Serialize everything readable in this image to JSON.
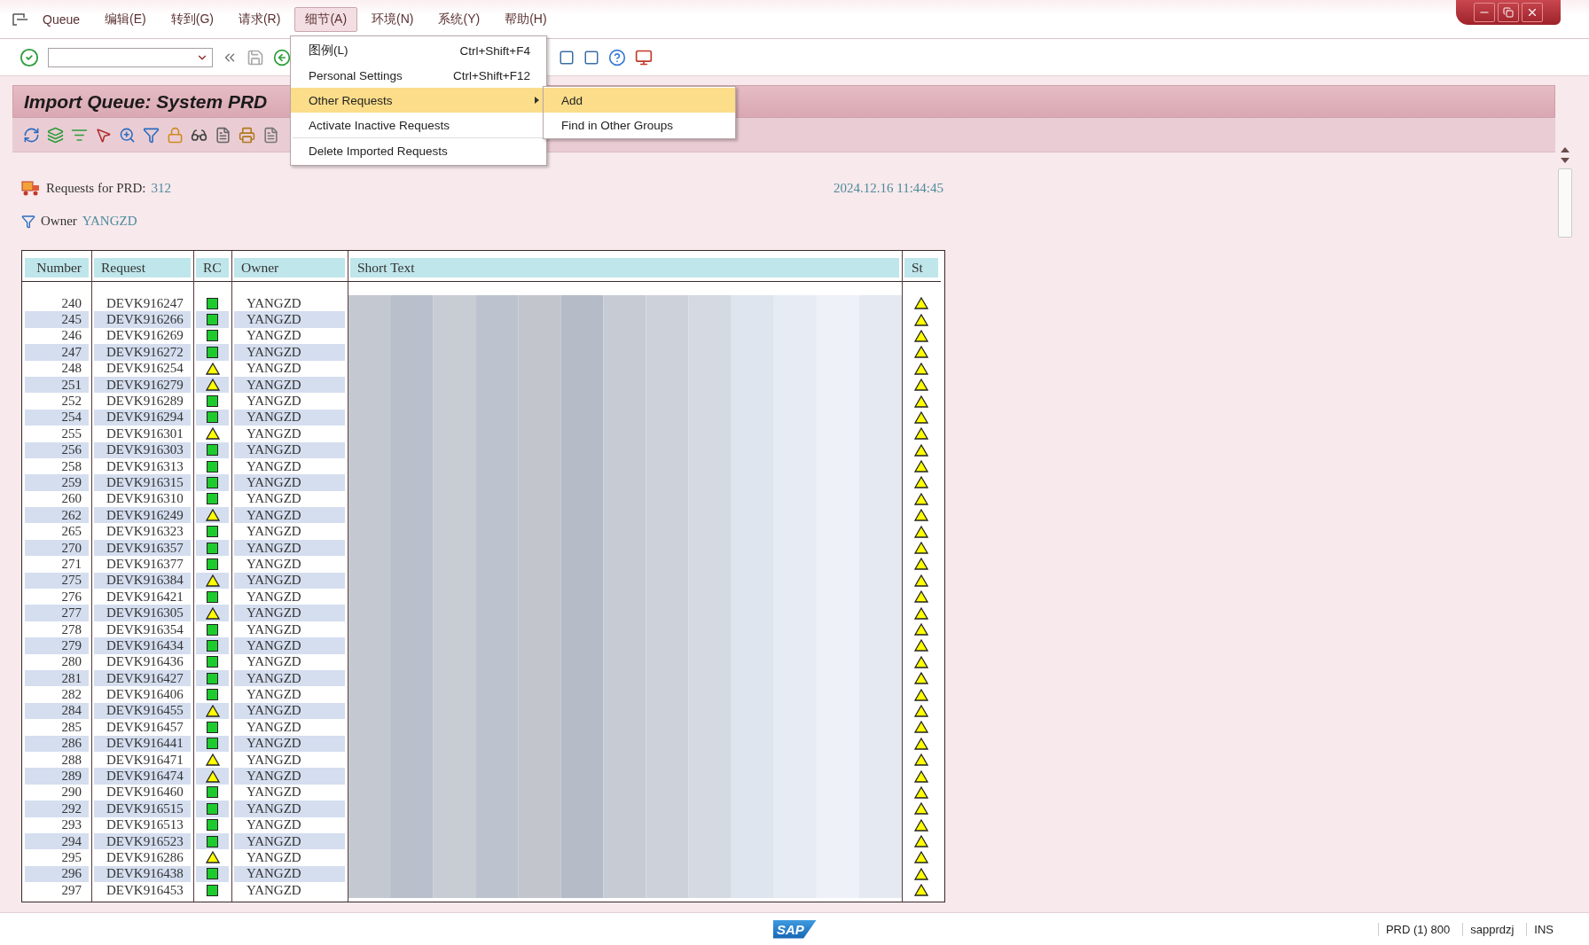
{
  "menu_bar": {
    "items": [
      {
        "label": "Queue",
        "selected": false
      },
      {
        "label": "编辑(E)",
        "selected": false
      },
      {
        "label": "转到(G)",
        "selected": false
      },
      {
        "label": "请求(R)",
        "selected": false
      },
      {
        "label": "细节(A)",
        "selected": true
      },
      {
        "label": "环境(N)",
        "selected": false
      },
      {
        "label": "系统(Y)",
        "selected": false
      },
      {
        "label": "帮助(H)",
        "selected": false
      }
    ]
  },
  "title": "Import Queue: System PRD",
  "info": {
    "requests_label": "Requests for PRD:",
    "requests_count": "312",
    "timestamp": "2024.12.16 11:44:45",
    "owner_label": "Owner",
    "owner_value": "YANGZD"
  },
  "table": {
    "columns": [
      "Number",
      "Request",
      "RC",
      "Owner",
      "Short Text",
      "St"
    ],
    "rows": [
      {
        "number": "240",
        "request": "DEVK916247",
        "rc_warning": false,
        "owner": "YANGZD",
        "st_warning": true
      },
      {
        "number": "245",
        "request": "DEVK916266",
        "rc_warning": false,
        "owner": "YANGZD",
        "st_warning": true
      },
      {
        "number": "246",
        "request": "DEVK916269",
        "rc_warning": false,
        "owner": "YANGZD",
        "st_warning": true
      },
      {
        "number": "247",
        "request": "DEVK916272",
        "rc_warning": false,
        "owner": "YANGZD",
        "st_warning": true
      },
      {
        "number": "248",
        "request": "DEVK916254",
        "rc_warning": true,
        "owner": "YANGZD",
        "st_warning": true
      },
      {
        "number": "251",
        "request": "DEVK916279",
        "rc_warning": true,
        "owner": "YANGZD",
        "st_warning": true
      },
      {
        "number": "252",
        "request": "DEVK916289",
        "rc_warning": false,
        "owner": "YANGZD",
        "st_warning": true
      },
      {
        "number": "254",
        "request": "DEVK916294",
        "rc_warning": false,
        "owner": "YANGZD",
        "st_warning": true
      },
      {
        "number": "255",
        "request": "DEVK916301",
        "rc_warning": true,
        "owner": "YANGZD",
        "st_warning": true
      },
      {
        "number": "256",
        "request": "DEVK916303",
        "rc_warning": false,
        "owner": "YANGZD",
        "st_warning": true
      },
      {
        "number": "258",
        "request": "DEVK916313",
        "rc_warning": false,
        "owner": "YANGZD",
        "st_warning": true
      },
      {
        "number": "259",
        "request": "DEVK916315",
        "rc_warning": false,
        "owner": "YANGZD",
        "st_warning": true
      },
      {
        "number": "260",
        "request": "DEVK916310",
        "rc_warning": false,
        "owner": "YANGZD",
        "st_warning": true
      },
      {
        "number": "262",
        "request": "DEVK916249",
        "rc_warning": true,
        "owner": "YANGZD",
        "st_warning": true
      },
      {
        "number": "265",
        "request": "DEVK916323",
        "rc_warning": false,
        "owner": "YANGZD",
        "st_warning": true
      },
      {
        "number": "270",
        "request": "DEVK916357",
        "rc_warning": false,
        "owner": "YANGZD",
        "st_warning": true
      },
      {
        "number": "271",
        "request": "DEVK916377",
        "rc_warning": false,
        "owner": "YANGZD",
        "st_warning": true
      },
      {
        "number": "275",
        "request": "DEVK916384",
        "rc_warning": true,
        "owner": "YANGZD",
        "st_warning": true
      },
      {
        "number": "276",
        "request": "DEVK916421",
        "rc_warning": false,
        "owner": "YANGZD",
        "st_warning": true
      },
      {
        "number": "277",
        "request": "DEVK916305",
        "rc_warning": true,
        "owner": "YANGZD",
        "st_warning": true
      },
      {
        "number": "278",
        "request": "DEVK916354",
        "rc_warning": false,
        "owner": "YANGZD",
        "st_warning": true
      },
      {
        "number": "279",
        "request": "DEVK916434",
        "rc_warning": false,
        "owner": "YANGZD",
        "st_warning": true
      },
      {
        "number": "280",
        "request": "DEVK916436",
        "rc_warning": false,
        "owner": "YANGZD",
        "st_warning": true
      },
      {
        "number": "281",
        "request": "DEVK916427",
        "rc_warning": false,
        "owner": "YANGZD",
        "st_warning": true
      },
      {
        "number": "282",
        "request": "DEVK916406",
        "rc_warning": false,
        "owner": "YANGZD",
        "st_warning": true
      },
      {
        "number": "284",
        "request": "DEVK916455",
        "rc_warning": true,
        "owner": "YANGZD",
        "st_warning": true
      },
      {
        "number": "285",
        "request": "DEVK916457",
        "rc_warning": false,
        "owner": "YANGZD",
        "st_warning": true
      },
      {
        "number": "286",
        "request": "DEVK916441",
        "rc_warning": false,
        "owner": "YANGZD",
        "st_warning": true
      },
      {
        "number": "288",
        "request": "DEVK916471",
        "rc_warning": true,
        "owner": "YANGZD",
        "st_warning": true
      },
      {
        "number": "289",
        "request": "DEVK916474",
        "rc_warning": true,
        "owner": "YANGZD",
        "st_warning": true
      },
      {
        "number": "290",
        "request": "DEVK916460",
        "rc_warning": false,
        "owner": "YANGZD",
        "st_warning": true
      },
      {
        "number": "292",
        "request": "DEVK916515",
        "rc_warning": false,
        "owner": "YANGZD",
        "st_warning": true
      },
      {
        "number": "293",
        "request": "DEVK916513",
        "rc_warning": false,
        "owner": "YANGZD",
        "st_warning": true
      },
      {
        "number": "294",
        "request": "DEVK916523",
        "rc_warning": false,
        "owner": "YANGZD",
        "st_warning": true
      },
      {
        "number": "295",
        "request": "DEVK916286",
        "rc_warning": true,
        "owner": "YANGZD",
        "st_warning": true
      },
      {
        "number": "296",
        "request": "DEVK916438",
        "rc_warning": false,
        "owner": "YANGZD",
        "st_warning": true
      },
      {
        "number": "297",
        "request": "DEVK916453",
        "rc_warning": false,
        "owner": "YANGZD",
        "st_warning": true
      }
    ]
  },
  "menu": {
    "items": [
      {
        "label": "图例(L)",
        "shortcut": "Ctrl+Shift+F4",
        "selected": false,
        "has_submenu": false,
        "separator_before": false
      },
      {
        "label": "Personal Settings",
        "shortcut": "Ctrl+Shift+F12",
        "selected": false,
        "has_submenu": false,
        "separator_before": false
      },
      {
        "label": "Other Requests",
        "selected": true,
        "has_submenu": true,
        "separator_before": false
      },
      {
        "label": "Activate Inactive Requests",
        "selected": false,
        "has_submenu": false,
        "separator_before": false
      },
      {
        "label": "Delete Imported Requests",
        "selected": false,
        "has_submenu": false,
        "separator_before": true
      }
    ]
  },
  "submenu": {
    "items": [
      {
        "label": "Add",
        "selected": true
      },
      {
        "label": "Find in Other Groups",
        "selected": false
      }
    ]
  },
  "status_bar": {
    "logo": "SAP",
    "items": [
      "PRD (1) 800",
      "sapprdzj",
      "INS"
    ]
  }
}
